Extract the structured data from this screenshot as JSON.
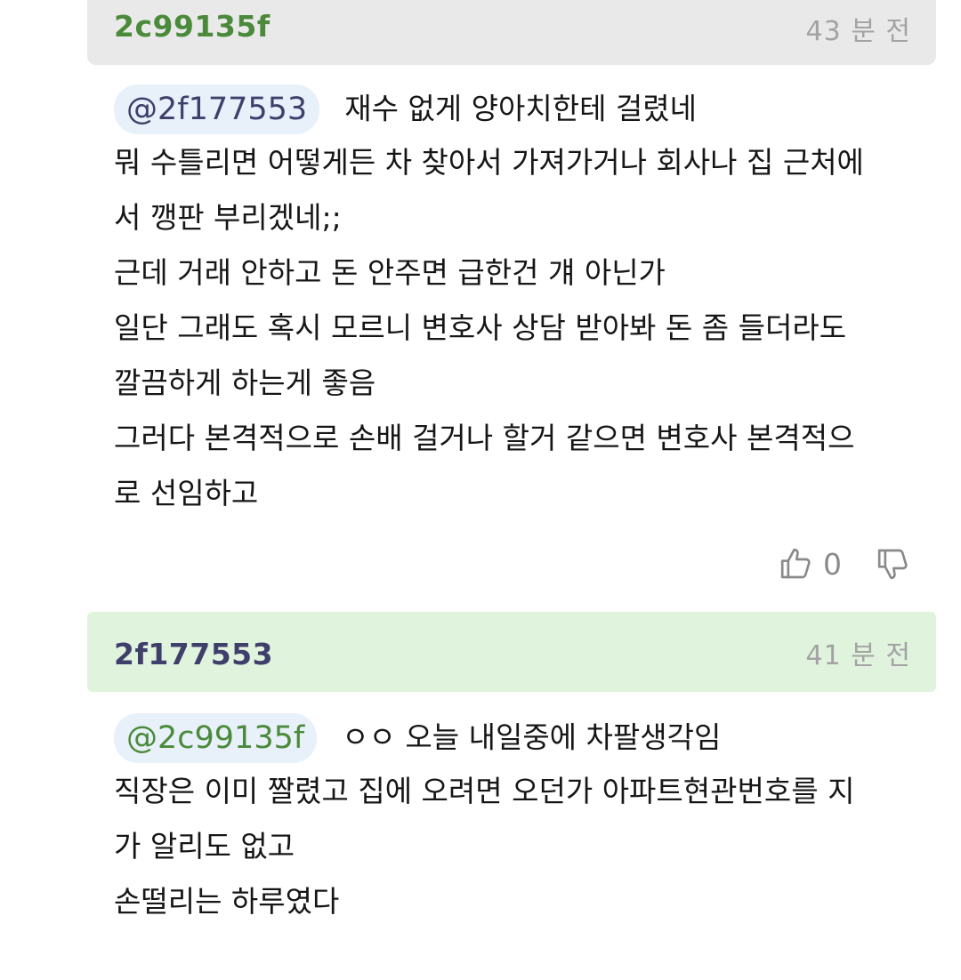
{
  "comments": [
    {
      "author": "2c99135f",
      "time": "43 분 전",
      "mention": "@2f177553",
      "first_line": "재수 없게 양아치한테 걸렸네",
      "lines": [
        "뭐 수틀리면 어떻게든 차 찾아서 가져가거나 회사나 집 근처에",
        "서 깽판 부리겠네;;",
        "근데 거래 안하고 돈 안주면 급한건 걔 아닌가",
        "일단 그래도 혹시 모르니 변호사 상담 받아봐 돈 좀 들더라도",
        "깔끔하게 하는게 좋음",
        "그러다 본격적으로 손배 걸거나 할거 같으면 변호사 본격적으",
        "로 선임하고"
      ],
      "like_count": "0",
      "icons": {
        "like": "thumbs-up-icon",
        "dislike": "thumbs-down-icon"
      }
    },
    {
      "author": "2f177553",
      "time": "41 분 전",
      "mention": "@2c99135f",
      "first_line": "ㅇㅇ 오늘 내일중에 차팔생각임",
      "lines": [
        "직장은 이미 짤렸고 집에 오려면 오던가 아파트현관번호를 지",
        "가 알리도 없고",
        "손떨리는 하루였다"
      ]
    }
  ],
  "colors": {
    "header_1_bg": "#e9e9e9",
    "header_2_bg": "#dff3dd",
    "author_1": "#4a8a3a",
    "author_2": "#3f3f6b",
    "time": "#a3a3a3",
    "mention_bg": "#e8f0fa"
  }
}
